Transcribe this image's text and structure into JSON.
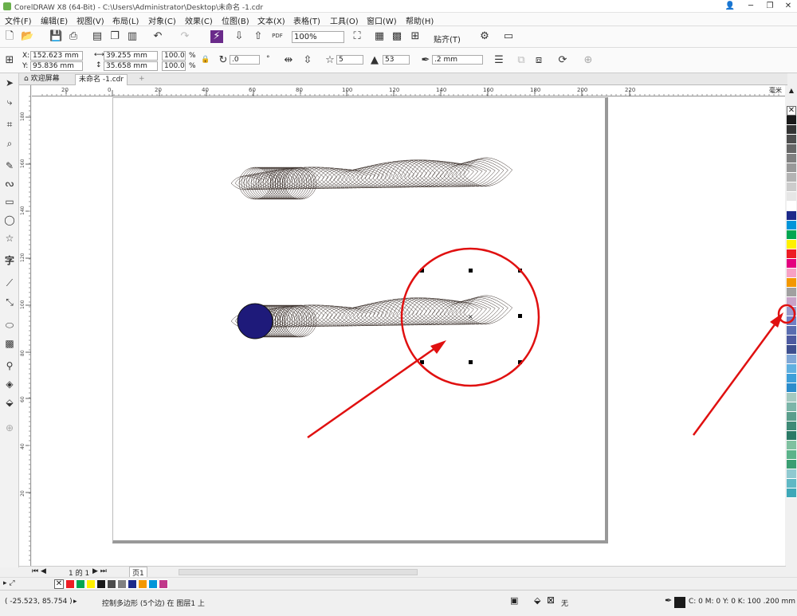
{
  "title": "CorelDRAW X8 (64-Bit) - C:\\Users\\Administrator\\Desktop\\未命名 -1.cdr",
  "window_buttons": [
    "👤",
    "─",
    "❐",
    "✕"
  ],
  "menu": [
    "文件(F)",
    "编辑(E)",
    "视图(V)",
    "布局(L)",
    "对象(C)",
    "效果(C)",
    "位图(B)",
    "文本(X)",
    "表格(T)",
    "工具(O)",
    "窗口(W)",
    "帮助(H)"
  ],
  "toolbar": {
    "zoom": "100%",
    "snap_label": "贴齐(T)",
    "pdf_label": "PDF"
  },
  "props": {
    "x_label": "X:",
    "y_label": "Y:",
    "x": "152.623 mm",
    "y": "95.836 mm",
    "w": "39.255 mm",
    "h": "35.658 mm",
    "sx": "100.0",
    "sy": "100.0",
    "pct": "%",
    "angle": ".0",
    "points": "5",
    "sharpness": "53",
    "outline": ".2 mm"
  },
  "tabs": {
    "welcome": "欢迎屏幕",
    "doc": "未命名 -1.cdr"
  },
  "ruler": {
    "units": "毫米",
    "h_ticks": [
      "20",
      "0",
      "20",
      "40",
      "60",
      "80",
      "100",
      "120",
      "140",
      "160",
      "180",
      "200",
      "220"
    ],
    "v_ticks": [
      "180",
      "160",
      "140",
      "120",
      "100",
      "80",
      "60",
      "40",
      "20"
    ]
  },
  "pager": {
    "page_of": "1 的 1",
    "page_tab": "页1"
  },
  "status": {
    "coords": "( -25.523, 85.754 )",
    "message": "控制多边形 (5个边) 在 图层1 上",
    "fill_none": "无",
    "outline_info": "C: 0 M: 0 Y: 0 K: 100 .200 mm"
  },
  "colors": {
    "accent_red": "#e01010",
    "circle_fill": "#1e1a7a",
    "line": "#3a2f2a"
  },
  "palette": [
    "#1a1a1a",
    "#333333",
    "#4d4d4d",
    "#666666",
    "#808080",
    "#999999",
    "#b3b3b3",
    "#cccccc",
    "#e6e6e6",
    "#ffffff",
    "#1d2a8a",
    "#0095d9",
    "#00a651",
    "#fff100",
    "#ed1c24",
    "#e4007f",
    "#f7a1c4",
    "#f39800",
    "#a0a0a0",
    "#c8a2c8",
    "#9999cc",
    "#6f7fc4",
    "#5a6db0",
    "#4d5aa0",
    "#3e4f8f",
    "#7fa7d6",
    "#5fb0e0",
    "#3d9fd9",
    "#2b8ccb",
    "#a3c9c0",
    "#7bb5a8",
    "#5a9e8c",
    "#3e8a76",
    "#2a7a66",
    "#7fc1a0",
    "#5ab38a",
    "#3a9e72",
    "#8fc9d0",
    "#5fb8c4",
    "#3ea8b8"
  ],
  "doc_palette": [
    "#ed1c24",
    "#00a651",
    "#fff100",
    "#1a1a1a",
    "#4d4d4d",
    "#808080",
    "#1d2a8a",
    "#f39800",
    "#0095d9",
    "#c0388a"
  ]
}
